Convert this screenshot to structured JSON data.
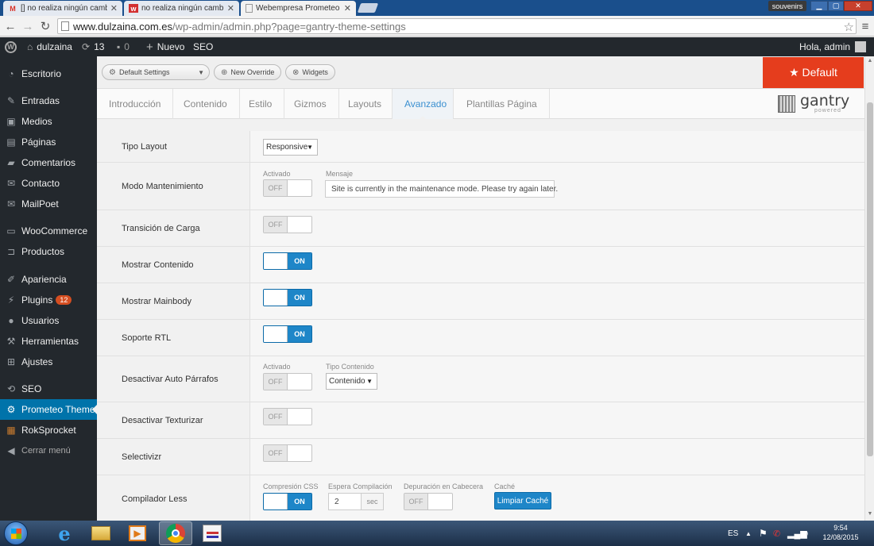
{
  "browser": {
    "tabs": [
      {
        "title": "[] no realiza ningún cambio",
        "favicon": "gmail-icon"
      },
      {
        "title": "no realiza ningún cambio",
        "favicon": "w-icon"
      },
      {
        "title": "Webempresa Prometeo Th",
        "favicon": "page-icon"
      }
    ],
    "user_badge": "souvenirs",
    "url_host": "www.dulzaina.com.es",
    "url_path": "/wp-admin/admin.php?page=gantry-theme-settings"
  },
  "adminbar": {
    "site_name": "dulzaina",
    "updates": "13",
    "comments": "0",
    "new_label": "Nuevo",
    "seo_label": "SEO",
    "greeting": "Hola, admin"
  },
  "sidebar": {
    "items": [
      {
        "label": "Escritorio",
        "icon": "dashboard-icon"
      },
      {
        "label": "Entradas",
        "icon": "pin-icon"
      },
      {
        "label": "Medios",
        "icon": "media-icon"
      },
      {
        "label": "Páginas",
        "icon": "pages-icon"
      },
      {
        "label": "Comentarios",
        "icon": "comment-icon"
      },
      {
        "label": "Contacto",
        "icon": "mail-icon"
      },
      {
        "label": "MailPoet",
        "icon": "mail-icon"
      },
      {
        "label": "WooCommerce",
        "icon": "woo-icon"
      },
      {
        "label": "Productos",
        "icon": "cart-icon"
      },
      {
        "label": "Apariencia",
        "icon": "brush-icon"
      },
      {
        "label": "Plugins",
        "icon": "plug-icon",
        "badge": "12"
      },
      {
        "label": "Usuarios",
        "icon": "user-icon"
      },
      {
        "label": "Herramientas",
        "icon": "wrench-icon"
      },
      {
        "label": "Ajustes",
        "icon": "settings-icon"
      },
      {
        "label": "SEO",
        "icon": "seo-icon"
      },
      {
        "label": "Prometeo Theme",
        "icon": "gear-icon"
      },
      {
        "label": "RokSprocket",
        "icon": "sprocket-icon"
      },
      {
        "label": "Cerrar menú",
        "icon": "collapse-icon"
      }
    ]
  },
  "toolbar": {
    "default_settings": "Default Settings",
    "new_override": "New Override",
    "widgets": "Widgets",
    "default_btn": "★ Default"
  },
  "tabs": [
    "Introducción",
    "Contenido",
    "Estilo",
    "Gizmos",
    "Layouts",
    "Avanzado",
    "Plantillas Página"
  ],
  "logo": {
    "text": "gantry",
    "sub": "powered"
  },
  "rows": {
    "tipo_layout": {
      "label": "Tipo Layout",
      "value": "Responsive"
    },
    "modo_mantenimiento": {
      "label": "Modo Mantenimiento",
      "activado": "Activado",
      "toggle": "OFF",
      "mensaje_label": "Mensaje",
      "mensaje_value": "Site is currently in the maintenance mode. Please try again later."
    },
    "transicion": {
      "label": "Transición de Carga",
      "toggle": "OFF"
    },
    "mostrar_contenido": {
      "label": "Mostrar Contenido",
      "toggle": "ON"
    },
    "mostrar_mainbody": {
      "label": "Mostrar Mainbody",
      "toggle": "ON"
    },
    "soporte_rtl": {
      "label": "Soporte RTL",
      "toggle": "ON"
    },
    "desactivar_auto": {
      "label": "Desactivar Auto Párrafos",
      "activado": "Activado",
      "toggle": "OFF",
      "tipo_label": "Tipo Contenido",
      "tipo_value": "Contenido"
    },
    "desactivar_texturizar": {
      "label": "Desactivar Texturizar",
      "toggle": "OFF"
    },
    "selectivizr": {
      "label": "Selectivizr",
      "toggle": "OFF"
    },
    "compilador_less": {
      "label": "Compilador Less",
      "compresion_label": "Compresión CSS",
      "compresion_toggle": "ON",
      "espera_label": "Espera Compilación",
      "espera_value": "2",
      "espera_unit": "sec",
      "depuracion_label": "Depuración en Cabecera",
      "depuracion_toggle": "OFF",
      "cache_label": "Caché",
      "cache_button": "Limpiar Caché"
    }
  },
  "taskbar": {
    "lang": "ES",
    "time": "9:54",
    "date": "12/08/2015"
  }
}
